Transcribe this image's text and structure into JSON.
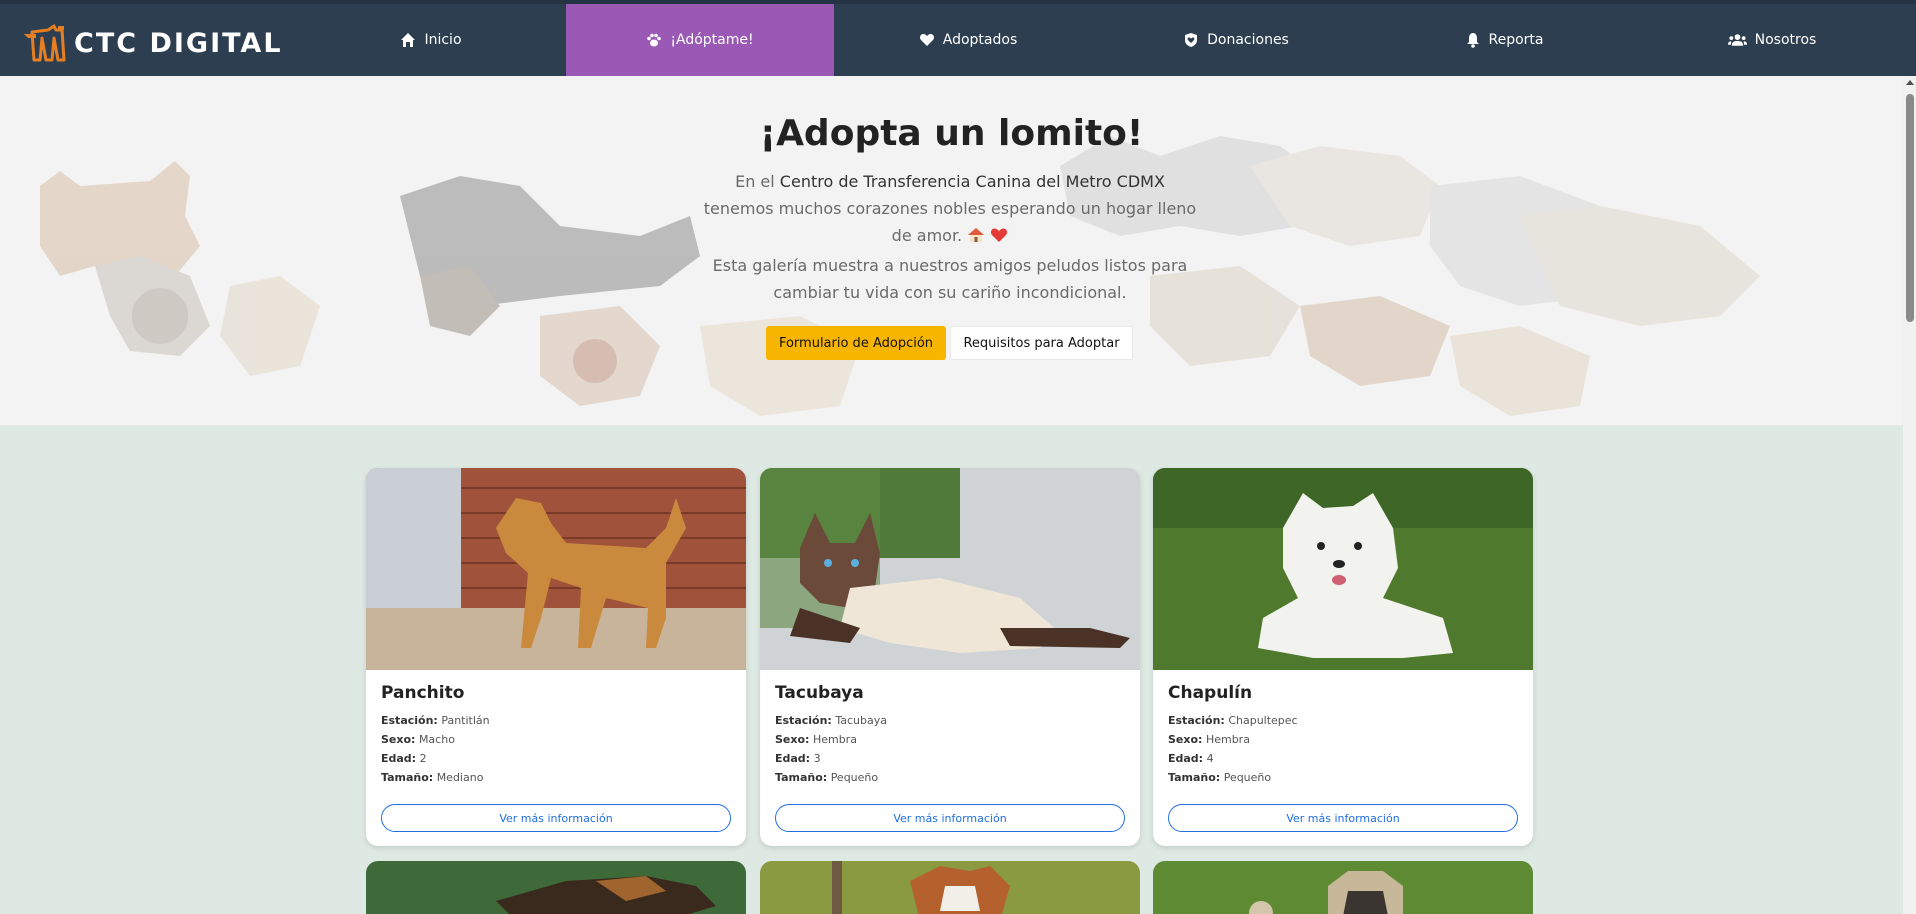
{
  "nav": {
    "brand": "CTC DIGITAL",
    "items": [
      {
        "label": "Inicio",
        "icon": "home-icon"
      },
      {
        "label": "¡Adóptame!",
        "icon": "paw-icon",
        "active": true
      },
      {
        "label": "Adoptados",
        "icon": "heart-icon"
      },
      {
        "label": "Donaciones",
        "icon": "shield-icon"
      },
      {
        "label": "Reporta",
        "icon": "bell-icon"
      },
      {
        "label": "Nosotros",
        "icon": "users-icon"
      }
    ],
    "colors": {
      "bg": "#2c3e50",
      "active": "#9b59b6"
    }
  },
  "hero": {
    "title": "¡Adopta un lomito!",
    "intro_prefix": "En el",
    "intro_strong": "Centro de Transferencia Canina del Metro CDMX",
    "intro_rest": "tenemos muchos corazones nobles esperando un hogar lleno de amor.",
    "description": "Esta galería muestra a nuestros amigos peludos listos para cambiar tu vida con su cariño incondicional.",
    "btn_form": "Formulario de Adopción",
    "btn_requirements": "Requisitos para Adoptar"
  },
  "labels": {
    "station": "Estación:",
    "sex": "Sexo:",
    "age": "Edad:",
    "size": "Tamaño:",
    "more_info": "Ver más información"
  },
  "cards": [
    {
      "name": "Panchito",
      "station": "Pantitlán",
      "sex": "Macho",
      "age": "2",
      "size": "Mediano"
    },
    {
      "name": "Tacubaya",
      "station": "Tacubaya",
      "sex": "Hembra",
      "age": "3",
      "size": "Pequeño"
    },
    {
      "name": "Chapulín",
      "station": "Chapultepec",
      "sex": "Hembra",
      "age": "4",
      "size": "Pequeño"
    }
  ]
}
